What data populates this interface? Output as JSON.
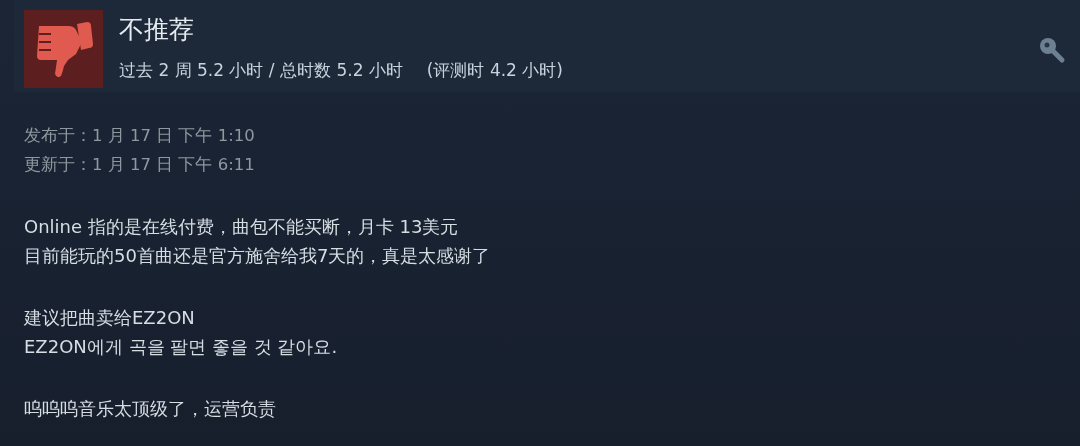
{
  "review": {
    "verdict": "不推荐",
    "recommended": false,
    "hours": "过去 2 周 5.2 小时 / 总时数 5.2 小时",
    "review_hours": "(评测时 4.2 小时)"
  },
  "dates": [
    "发布于：1 月 17 日 下午 1:10",
    "更新于：1 月 17 日 下午 6:11"
  ],
  "paragraphs": [
    [
      "Online 指的是在线付费，曲包不能买断，月卡 13美元",
      "目前能玩的50首曲还是官方施舍给我7天的，真是太感谢了"
    ],
    [
      "建议把曲卖给EZ2ON",
      "EZ2ON에게 곡을 팔면 좋을 것 같아요."
    ],
    [
      "呜呜呜音乐太顶级了，运营负责"
    ]
  ]
}
